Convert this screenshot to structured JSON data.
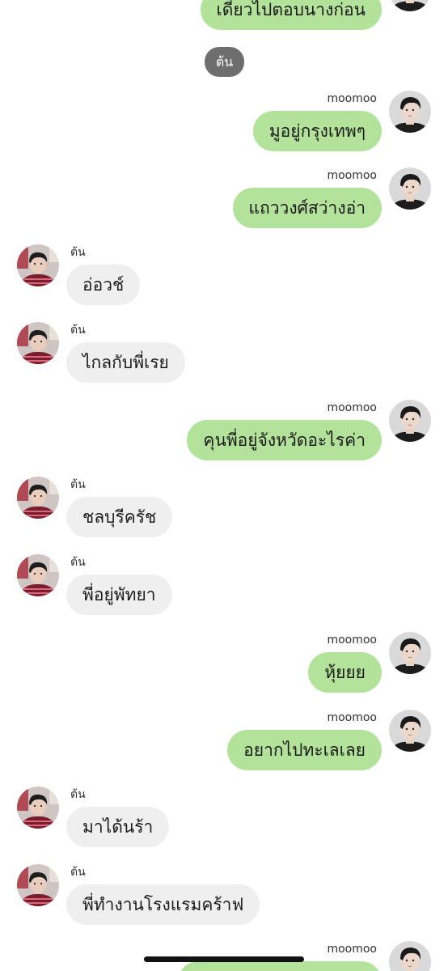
{
  "partner_name": "ต้น",
  "messages": [
    {
      "dir": "out",
      "sender": "",
      "text": "เดี๋ยวไปตอบนางก่อน",
      "avatar": "avatar-moomoo-icon"
    },
    {
      "dir": "out",
      "sender": "moomoo",
      "text": "มูอยู่กรุงเทพๆ",
      "avatar": "avatar-moomoo-icon"
    },
    {
      "dir": "out",
      "sender": "moomoo",
      "text": "แถววงศ์สว่างอ่า",
      "avatar": "avatar-moomoo-icon"
    },
    {
      "dir": "in",
      "sender": "ต้น",
      "text": "อ่อวช์",
      "avatar": "avatar-ton-icon"
    },
    {
      "dir": "in",
      "sender": "ต้น",
      "text": "ไกลกับพี่เรย",
      "avatar": "avatar-ton-icon"
    },
    {
      "dir": "out",
      "sender": "moomoo",
      "text": "คุนพี่อยู่จังหวัดอะไรค่า",
      "avatar": "avatar-moomoo-icon"
    },
    {
      "dir": "in",
      "sender": "ต้น",
      "text": "ชลบุรีครัช",
      "avatar": "avatar-ton-icon"
    },
    {
      "dir": "in",
      "sender": "ต้น",
      "text": "พี่อยู่พัทยา",
      "avatar": "avatar-ton-icon"
    },
    {
      "dir": "out",
      "sender": "moomoo",
      "text": "หุ้ยยย",
      "avatar": "avatar-moomoo-icon"
    },
    {
      "dir": "out",
      "sender": "moomoo",
      "text": "อยากไปทะเลเลย",
      "avatar": "avatar-moomoo-icon"
    },
    {
      "dir": "in",
      "sender": "ต้น",
      "text": "มาได้นร้า",
      "avatar": "avatar-ton-icon"
    },
    {
      "dir": "in",
      "sender": "ต้น",
      "text": "พี่ทำงานโรงแรมคร้าฟ",
      "avatar": "avatar-ton-icon"
    },
    {
      "dir": "out",
      "sender": "moomoo",
      "text": "",
      "avatar": "avatar-moomoo-icon"
    }
  ],
  "colors": {
    "outgoing_bubble": "#b3e29b",
    "incoming_bubble": "#efefef",
    "name_pill": "#6e6e6e"
  }
}
